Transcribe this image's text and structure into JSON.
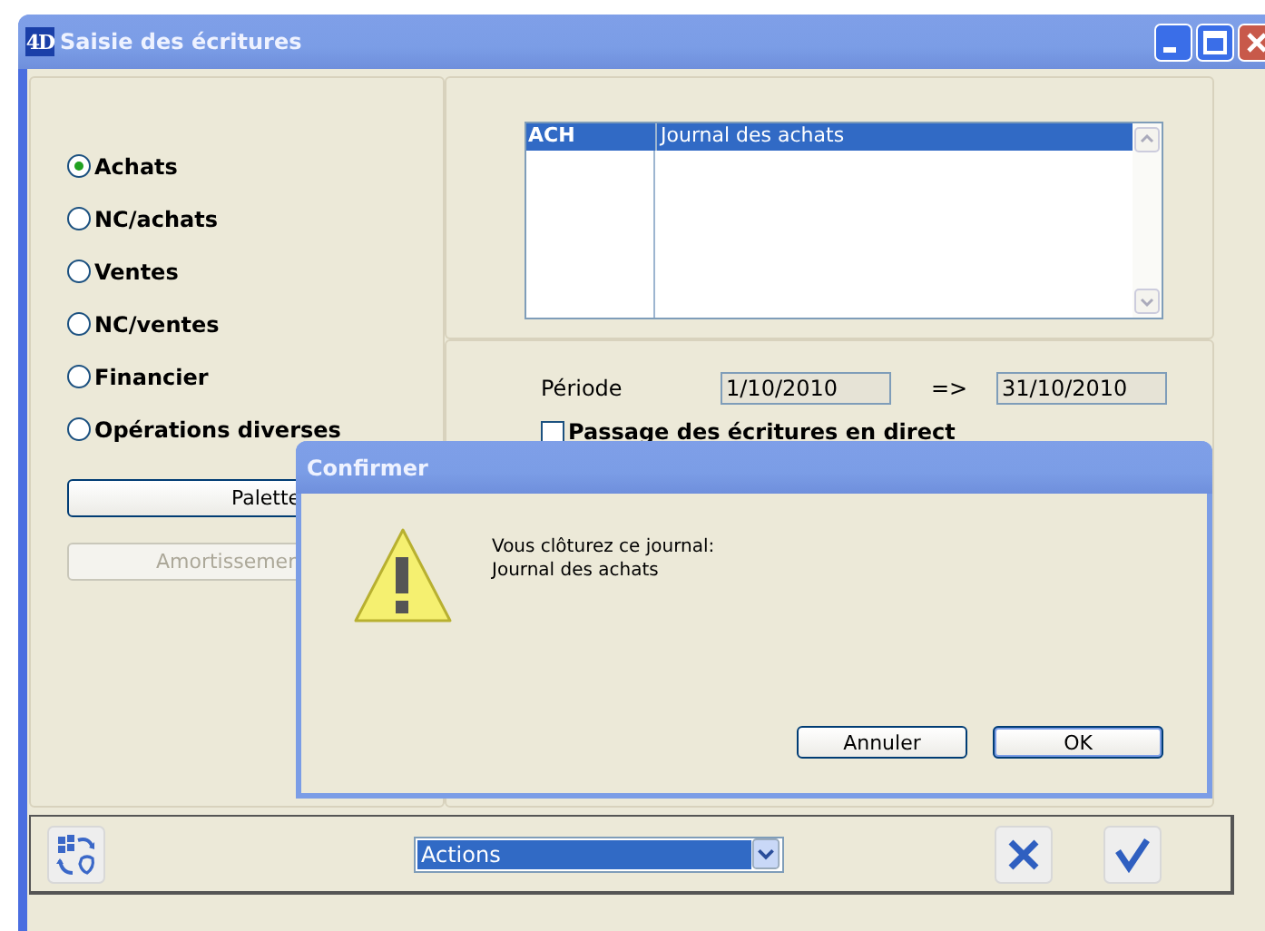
{
  "window": {
    "logo": "4D",
    "title": "Saisie des écritures"
  },
  "journal_types": [
    {
      "label": "Achats",
      "selected": true
    },
    {
      "label": "NC/achats",
      "selected": false
    },
    {
      "label": "Ventes",
      "selected": false
    },
    {
      "label": "NC/ventes",
      "selected": false
    },
    {
      "label": "Financier",
      "selected": false
    },
    {
      "label": "Opérations diverses",
      "selected": false
    }
  ],
  "left_buttons": [
    {
      "label": "Palette",
      "disabled": false
    },
    {
      "label": "Amortissemen",
      "disabled": true
    }
  ],
  "journal_list": [
    {
      "code": "ACH",
      "name": "Journal des achats",
      "selected": true
    }
  ],
  "period": {
    "label": "Période",
    "from": "1/10/2010",
    "arrow": "=>",
    "to": "31/10/2010"
  },
  "direct_posting": {
    "label": "Passage des écritures en direct",
    "checked": false
  },
  "toolbar": {
    "actions_select": "Actions"
  },
  "dialog": {
    "title": "Confirmer",
    "message": [
      "Vous clôturez ce journal:",
      "Journal des achats"
    ],
    "buttons": [
      {
        "label": "Annuler",
        "default": false
      },
      {
        "label": "OK",
        "default": true
      }
    ]
  }
}
